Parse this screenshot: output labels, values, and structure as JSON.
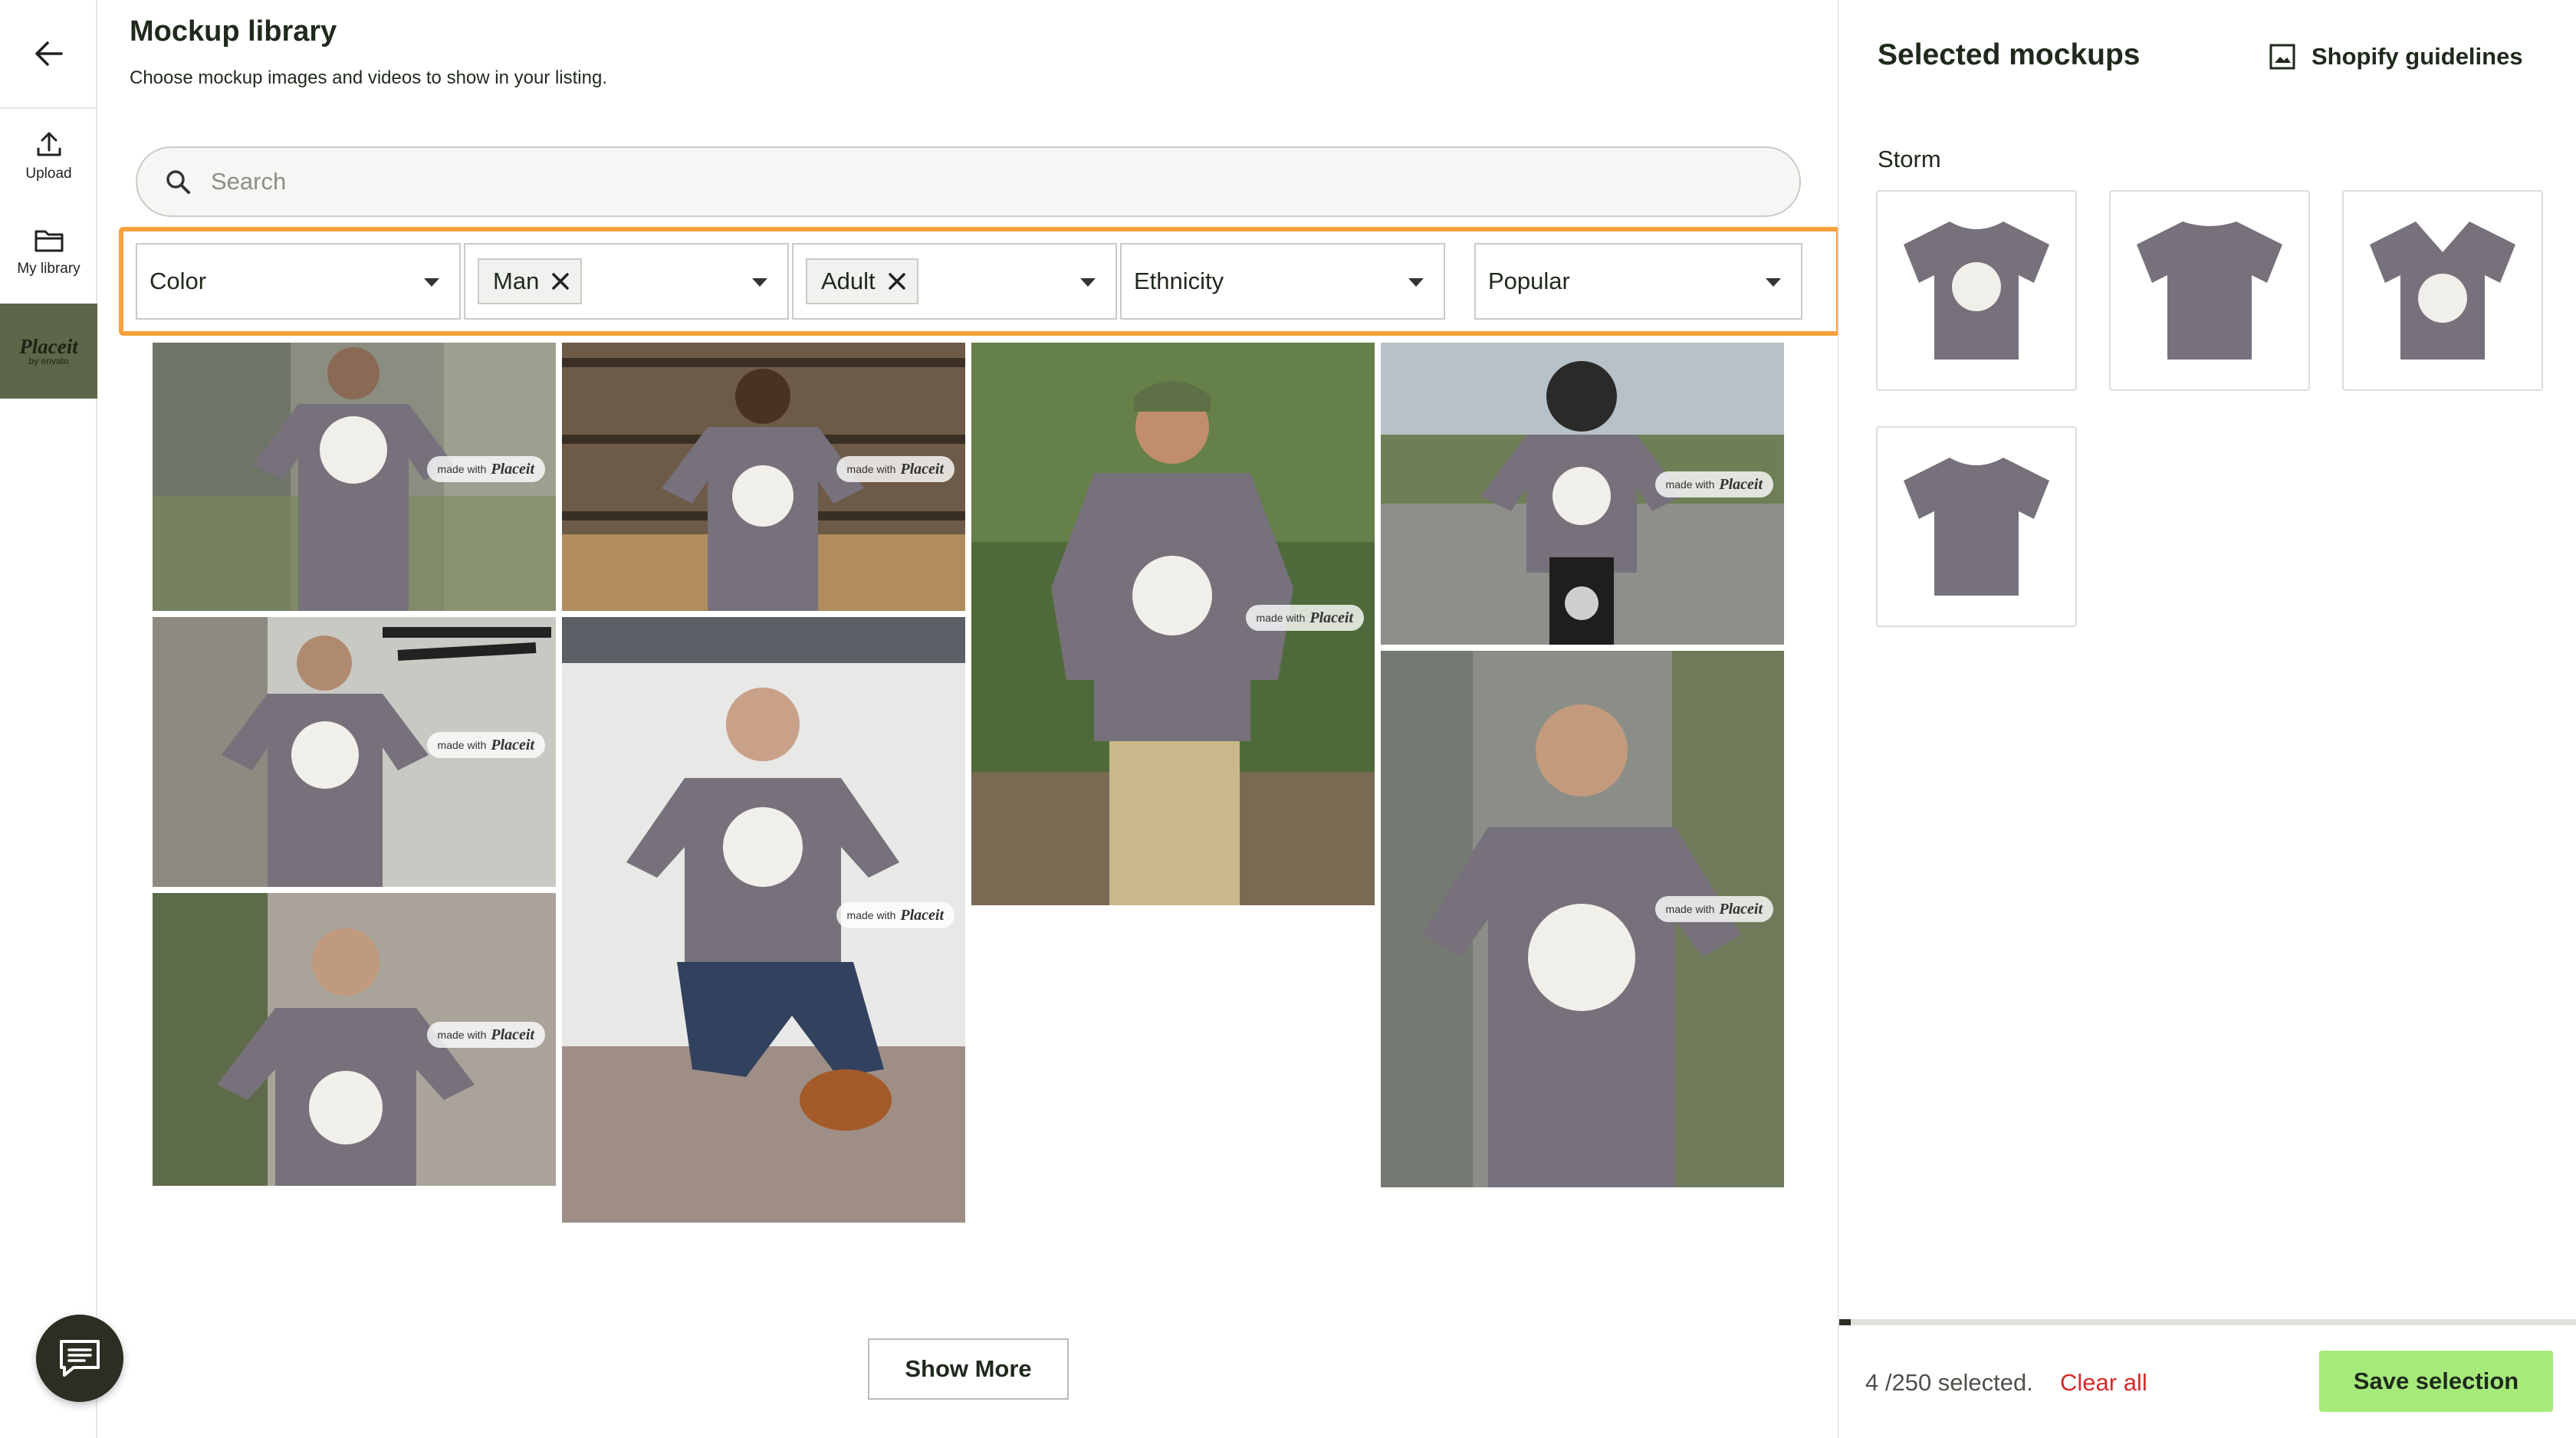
{
  "rail": {
    "upload_label": "Upload",
    "library_label": "My library",
    "placeit_brand": "Placeit",
    "placeit_sub": "by envato"
  },
  "main": {
    "title": "Mockup library",
    "subtitle": "Choose mockup images and videos to show in your listing.",
    "search_placeholder": "Search",
    "filters": {
      "color_label": "Color",
      "gender_chip": "Man",
      "age_chip": "Adult",
      "ethnicity_label": "Ethnicity",
      "sort_label": "Popular"
    },
    "watermark": {
      "made_with": "made with",
      "brand": "Placeit"
    },
    "show_more_label": "Show More"
  },
  "panel": {
    "title": "Selected mockups",
    "guidelines_label": "Shopify guidelines",
    "group_label": "Storm",
    "selected_count": "4 /250 selected.",
    "clear_all_label": "Clear all",
    "save_label": "Save selection",
    "progress_fraction": 0.016
  },
  "colors": {
    "shirt": "#76717a",
    "accent_orange": "#f7a23a",
    "save_green": "#a7ea7c",
    "clear_red": "#d62a2a",
    "placeit_olive": "#5d6649"
  }
}
